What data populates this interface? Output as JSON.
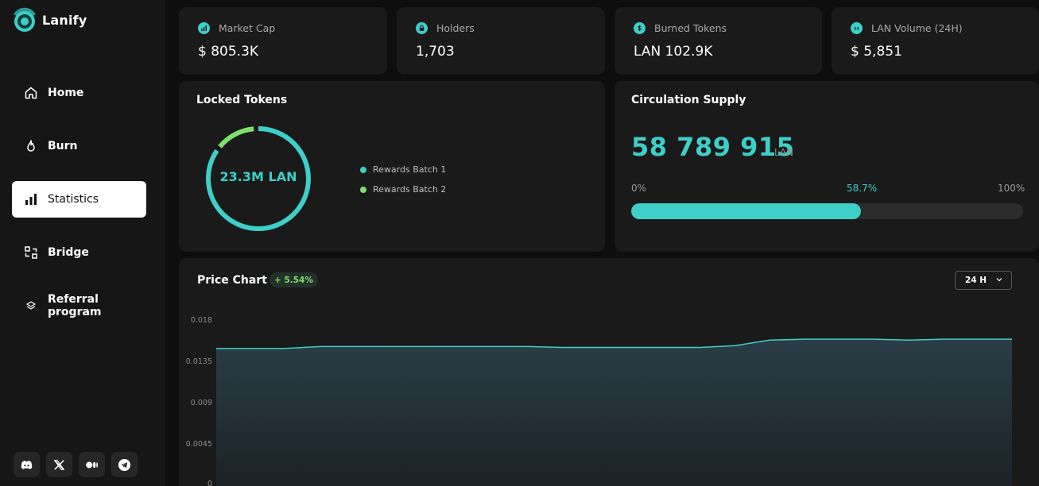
{
  "app": {
    "name": "Lanify"
  },
  "nav": [
    {
      "label": "Home",
      "icon": "home-icon",
      "active": false
    },
    {
      "label": "Burn",
      "icon": "flame-icon",
      "active": false
    },
    {
      "label": "Statistics",
      "icon": "bar-chart-icon",
      "active": true
    },
    {
      "label": "Bridge",
      "icon": "bridge-icon",
      "active": false
    },
    {
      "label": "Referral program",
      "icon": "layers-icon",
      "active": false
    }
  ],
  "socials": [
    "discord-icon",
    "x-icon",
    "medium-icon",
    "telegram-icon"
  ],
  "stats": [
    {
      "label": "Market Cap",
      "value": "$ 805.3K",
      "icon": "chart-icon"
    },
    {
      "label": "Holders",
      "value": "1,703",
      "icon": "lock-icon"
    },
    {
      "label": "Burned Tokens",
      "value": "LAN 102.9K",
      "icon": "dollar-icon"
    },
    {
      "label": "LAN Volume (24H)",
      "value": "$ 5,851",
      "icon": "24h-icon"
    }
  ],
  "locked": {
    "title": "Locked Tokens",
    "center": "23.3M LAN",
    "segments": [
      {
        "label": "Rewards Batch 1",
        "share": 0.86,
        "color": "#3ecfc9"
      },
      {
        "label": "Rewards Batch 2",
        "share": 0.14,
        "color": "#7ee06a"
      }
    ]
  },
  "supply": {
    "title": "Circulation Supply",
    "value": "58 789 915",
    "unit": "LAN",
    "min_label": "0%",
    "percent_label": "58.7%",
    "max_label": "100%",
    "percent": 58.7
  },
  "price_chart": {
    "title": "Price Chart",
    "change": "+ 5.54%",
    "range": "24 H"
  },
  "colors": {
    "accent": "#3ecfc9",
    "positive": "#7ee06a",
    "card": "#1a1a1a",
    "background": "#0e0e0e"
  },
  "chart_data": {
    "type": "area",
    "title": "Price Chart",
    "xlabel": "",
    "ylabel": "",
    "ylim": [
      0,
      0.018
    ],
    "yticks": [
      "0.018",
      "0.0135",
      "0.009",
      "0.0045",
      "0"
    ],
    "grid": false,
    "x": [
      0,
      1,
      2,
      3,
      4,
      5,
      6,
      7,
      8,
      9,
      10,
      11,
      12,
      13,
      14,
      15,
      16,
      17,
      18,
      19,
      20,
      21,
      22,
      23
    ],
    "series": [
      {
        "values": [
          0.015,
          0.015,
          0.015,
          0.0152,
          0.0152,
          0.0152,
          0.0152,
          0.0152,
          0.0152,
          0.0152,
          0.0151,
          0.0151,
          0.0151,
          0.0151,
          0.0151,
          0.0153,
          0.0159,
          0.016,
          0.016,
          0.016,
          0.0159,
          0.016,
          0.016,
          0.016
        ]
      }
    ]
  }
}
